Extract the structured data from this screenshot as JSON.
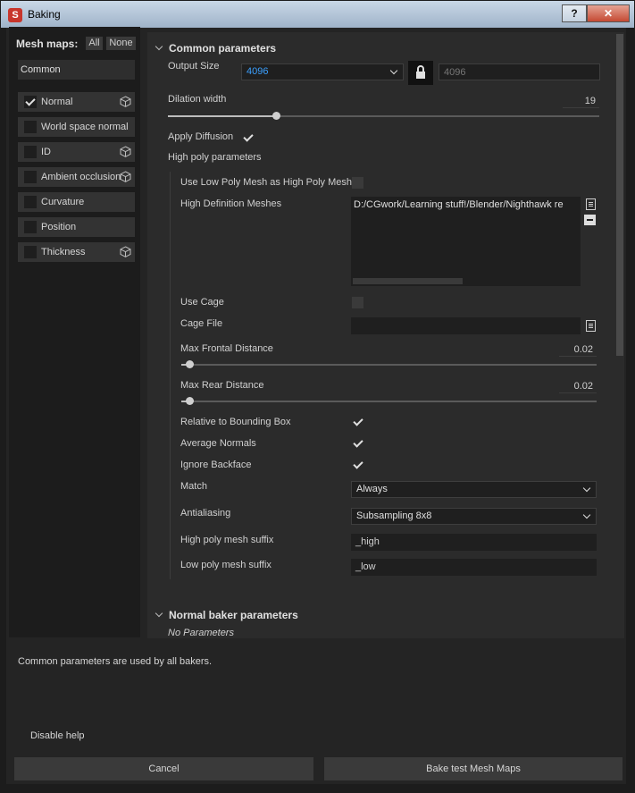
{
  "window": {
    "title": "Baking",
    "help_label": "?",
    "close_label": "✕"
  },
  "left": {
    "mesh_maps_label": "Mesh maps:",
    "all_label": "All",
    "none_label": "None",
    "common_label": "Common",
    "maps": [
      {
        "label": "Normal",
        "checked": true,
        "cube": true
      },
      {
        "label": "World space normal",
        "checked": false,
        "cube": false
      },
      {
        "label": "ID",
        "checked": false,
        "cube": true
      },
      {
        "label": "Ambient occlusion",
        "checked": false,
        "cube": true
      },
      {
        "label": "Curvature",
        "checked": false,
        "cube": false
      },
      {
        "label": "Position",
        "checked": false,
        "cube": false
      },
      {
        "label": "Thickness",
        "checked": false,
        "cube": true
      }
    ]
  },
  "common": {
    "header": "Common parameters",
    "output_size_label": "Output Size",
    "output_size_value": "4096",
    "output_size_linked": "4096",
    "dilation_label": "Dilation width",
    "dilation_value": "19",
    "dilation_fraction": 0.25,
    "apply_diffusion_label": "Apply Diffusion",
    "high_poly_label": "High poly parameters",
    "use_low_poly_label": "Use Low Poly Mesh as High Poly Mesh",
    "hd_meshes_label": "High Definition Meshes",
    "hd_mesh_path": "D:/CGwork/Learning stuff!/Blender/Nighthawk re",
    "use_cage_label": "Use Cage",
    "cage_file_label": "Cage File",
    "max_frontal_label": "Max Frontal Distance",
    "max_frontal_value": "0.02",
    "max_frontal_fraction": 0.02,
    "max_rear_label": "Max Rear Distance",
    "max_rear_value": "0.02",
    "max_rear_fraction": 0.02,
    "relative_bbox_label": "Relative to Bounding Box",
    "average_normals_label": "Average Normals",
    "ignore_backface_label": "Ignore Backface",
    "match_label": "Match",
    "match_value": "Always",
    "antialiasing_label": "Antialiasing",
    "antialiasing_value": "Subsampling 8x8",
    "high_suffix_label": "High poly mesh suffix",
    "high_suffix_value": "_high",
    "low_suffix_label": "Low poly mesh suffix",
    "low_suffix_value": "_low"
  },
  "normal_baker": {
    "header": "Normal baker parameters",
    "no_params": "No Parameters"
  },
  "help": {
    "text": "Common parameters are used by all bakers.",
    "disable_label": "Disable help"
  },
  "footer": {
    "cancel_label": "Cancel",
    "bake_label": "Bake test Mesh Maps"
  },
  "colors": {
    "accent_blue": "#3ba0ff",
    "panel_bg": "#2b2b2b",
    "window_bg": "#242424"
  }
}
